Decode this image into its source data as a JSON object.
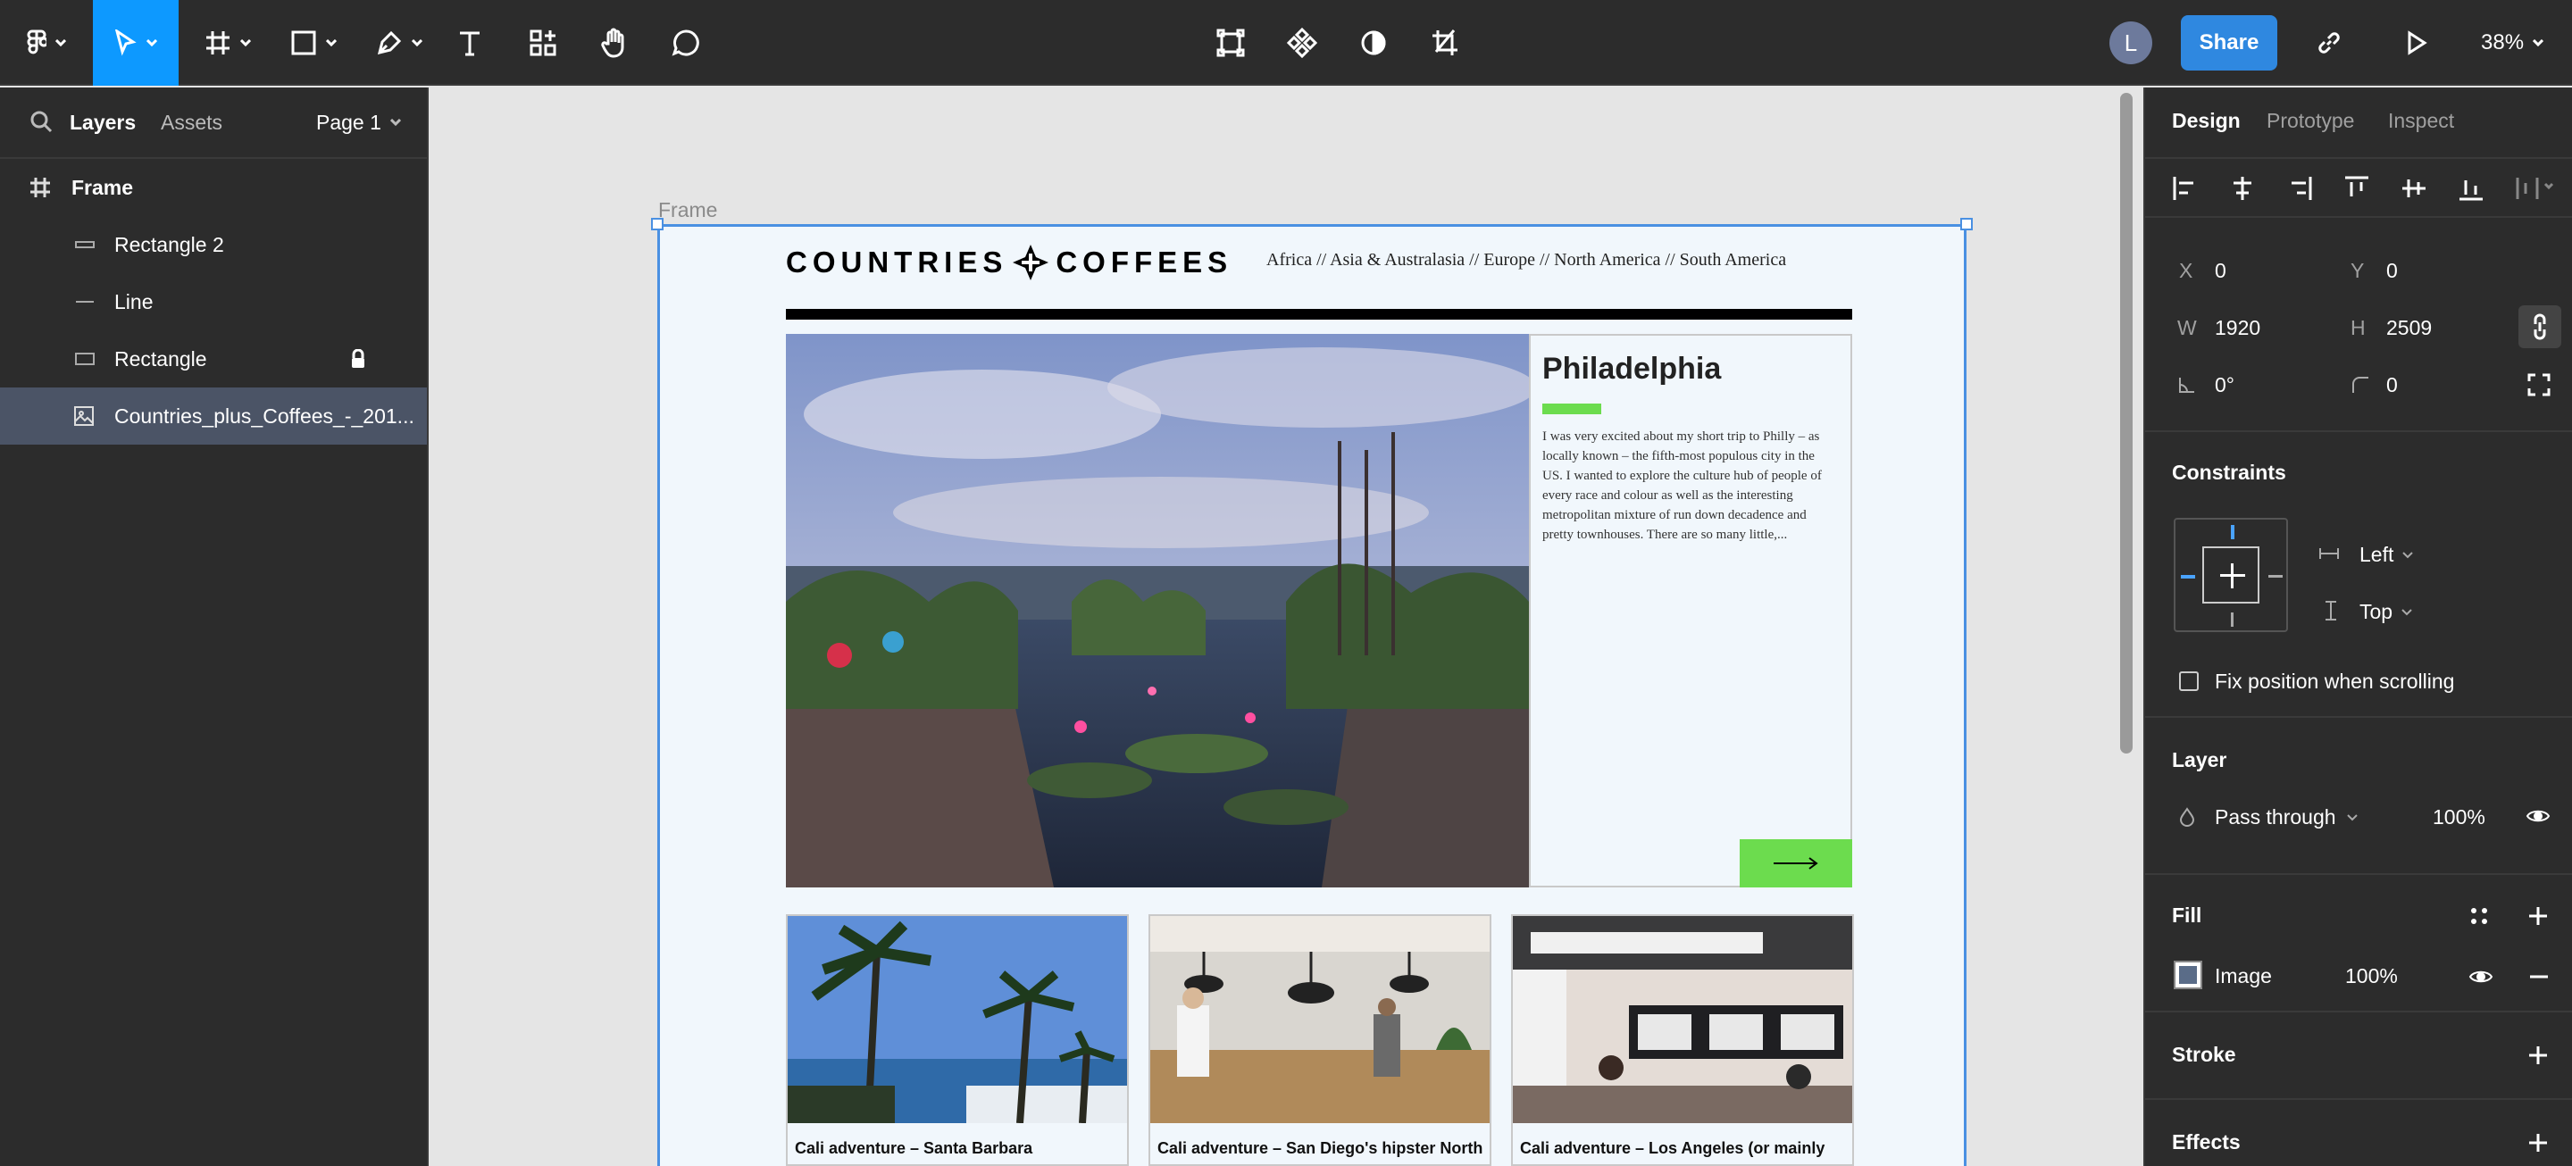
{
  "toolbar": {
    "zoom": "38%",
    "share_label": "Share",
    "avatar_initial": "L"
  },
  "left_panel": {
    "tabs": [
      "Layers",
      "Assets"
    ],
    "page": "Page 1",
    "layers": [
      {
        "name": "Frame",
        "icon": "frame-icon",
        "bold": true
      },
      {
        "name": "Rectangle 2",
        "icon": "rectangle-icon"
      },
      {
        "name": "Line",
        "icon": "line-icon"
      },
      {
        "name": "Rectangle",
        "icon": "rectangle-icon",
        "locked": true
      },
      {
        "name": "Countries_plus_Coffees_-_201...",
        "icon": "image-icon",
        "selected": true
      }
    ]
  },
  "canvas": {
    "frame_label": "Frame",
    "site": {
      "logo_left": "COUNTRIES",
      "logo_right": "COFFEES",
      "nav": "Africa  //  Asia & Australasia  //  Europe  //  North America  //  South America",
      "hero_title": "Philadelphia",
      "hero_text": "I was very excited about my short trip to Philly – as locally known – the fifth-most populous city in the US. I wanted to explore the culture hub of people of every race and colour as well as the interesting metropolitan mixture of run down decadence and pretty townhouses. There are so many little,...",
      "cards": [
        "Cali adventure – Santa Barbara",
        "Cali adventure – San Diego's hipster North",
        "Cali adventure – Los Angeles (or mainly"
      ]
    }
  },
  "right_panel": {
    "tabs": [
      "Design",
      "Prototype",
      "Inspect"
    ],
    "x_label": "X",
    "x": "0",
    "y_label": "Y",
    "y": "0",
    "w_label": "W",
    "w": "1920",
    "h_label": "H",
    "h": "2509",
    "rotation": "0°",
    "radius": "0",
    "constraints_title": "Constraints",
    "constraint_h": "Left",
    "constraint_v": "Top",
    "fix_scroll": "Fix position when scrolling",
    "layer_title": "Layer",
    "blend": "Pass through",
    "opacity": "100%",
    "fill_title": "Fill",
    "fill_type": "Image",
    "fill_opacity": "100%",
    "stroke_title": "Stroke",
    "effects_title": "Effects"
  }
}
